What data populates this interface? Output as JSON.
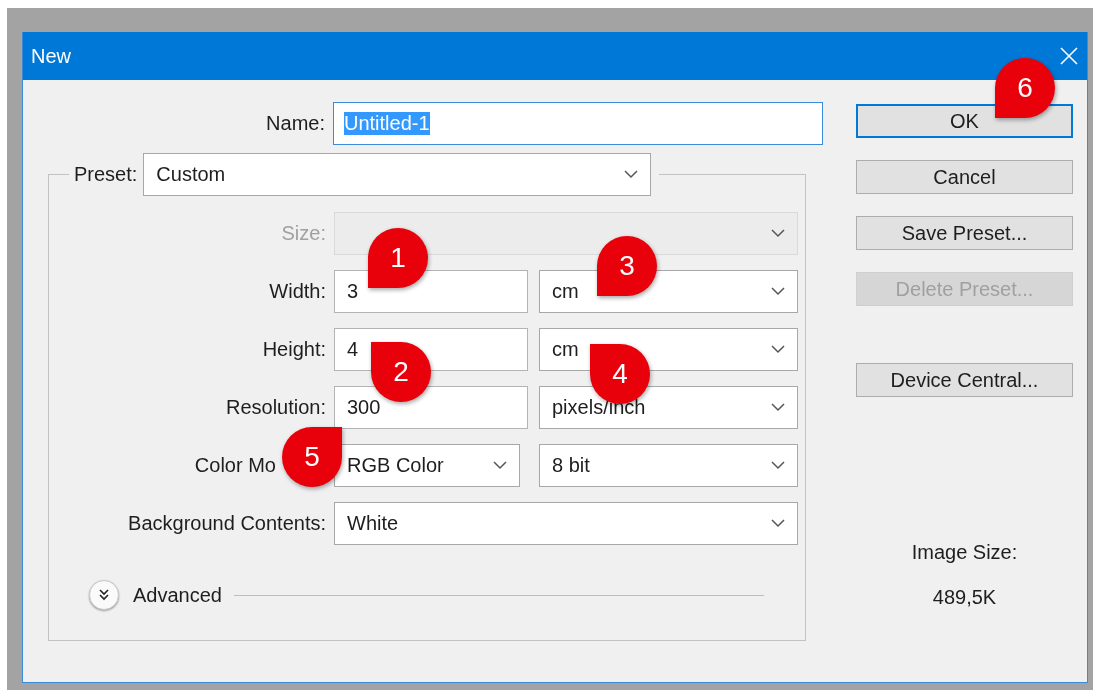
{
  "window": {
    "title": "New"
  },
  "name_field": {
    "label": "Name:",
    "value": "Untitled-1",
    "text_selected": true
  },
  "preset": {
    "label": "Preset:",
    "value": "Custom"
  },
  "rows": [
    {
      "label": "Size:",
      "disabled": true,
      "controls": [
        {
          "kind": "select"
        }
      ]
    },
    {
      "label": "Width:",
      "disabled": false,
      "controls": [
        {
          "kind": "text",
          "value": "3"
        },
        {
          "kind": "select",
          "value": "cm"
        }
      ]
    },
    {
      "label": "Height:",
      "disabled": false,
      "controls": [
        {
          "kind": "text",
          "value": "4"
        },
        {
          "kind": "select",
          "value": "cm"
        }
      ]
    },
    {
      "label": "Resolution:",
      "disabled": false,
      "controls": [
        {
          "kind": "text",
          "value": "300"
        },
        {
          "kind": "select",
          "value": "pixels/inch"
        }
      ]
    },
    {
      "label": "Color Mo",
      "disabled": false,
      "controls": [
        {
          "kind": "select",
          "value": "RGB Color"
        },
        {
          "kind": "select",
          "value": "8 bit"
        }
      ]
    },
    {
      "label": "Background Contents:",
      "disabled": false,
      "controls": [
        {
          "kind": "select",
          "value": "White"
        }
      ]
    }
  ],
  "advanced": {
    "label": "Advanced",
    "expanded": false
  },
  "buttons": [
    {
      "label": "OK",
      "default": true,
      "disabled": false
    },
    {
      "label": "Cancel",
      "default": false,
      "disabled": false
    },
    {
      "label": "Save Preset...",
      "default": false,
      "disabled": false
    },
    {
      "label": "Delete Preset...",
      "default": false,
      "disabled": true
    },
    {
      "label": "Device Central...",
      "default": false,
      "disabled": false
    }
  ],
  "image_size": {
    "label": "Image Size:",
    "value": "489,5K"
  },
  "annotations": [
    {
      "label": "1"
    },
    {
      "label": "2"
    },
    {
      "label": "3"
    },
    {
      "label": "4"
    },
    {
      "label": "5"
    },
    {
      "label": "6"
    }
  ]
}
